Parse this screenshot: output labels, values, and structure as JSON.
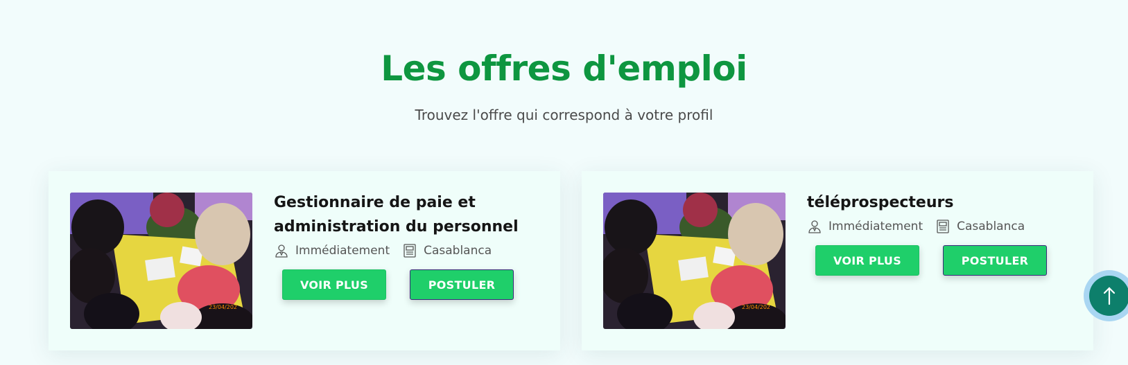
{
  "section": {
    "title": "Les offres d'emploi",
    "subtitle": "Trouvez l'offre qui correspond à votre profil"
  },
  "jobs": [
    {
      "title": "Gestionnaire de paie et administration du personnel",
      "availability": "Immédiatement",
      "location": "Casablanca",
      "more_label": "VOIR PLUS",
      "apply_label": "POSTULER",
      "photo_date": "23/04/202"
    },
    {
      "title": "téléprospecteurs",
      "availability": "Immédiatement",
      "location": "Casablanca",
      "more_label": "VOIR PLUS",
      "apply_label": "POSTULER",
      "photo_date": "23/04/202"
    }
  ],
  "icons": {
    "availability": "person-icon",
    "location": "document-icon",
    "scroll_top": "arrow-up-icon"
  },
  "colors": {
    "title": "#0e9640",
    "button": "#1fcf6a",
    "background": "#f2fcfc",
    "scroll_top": "#0d7f6b"
  }
}
